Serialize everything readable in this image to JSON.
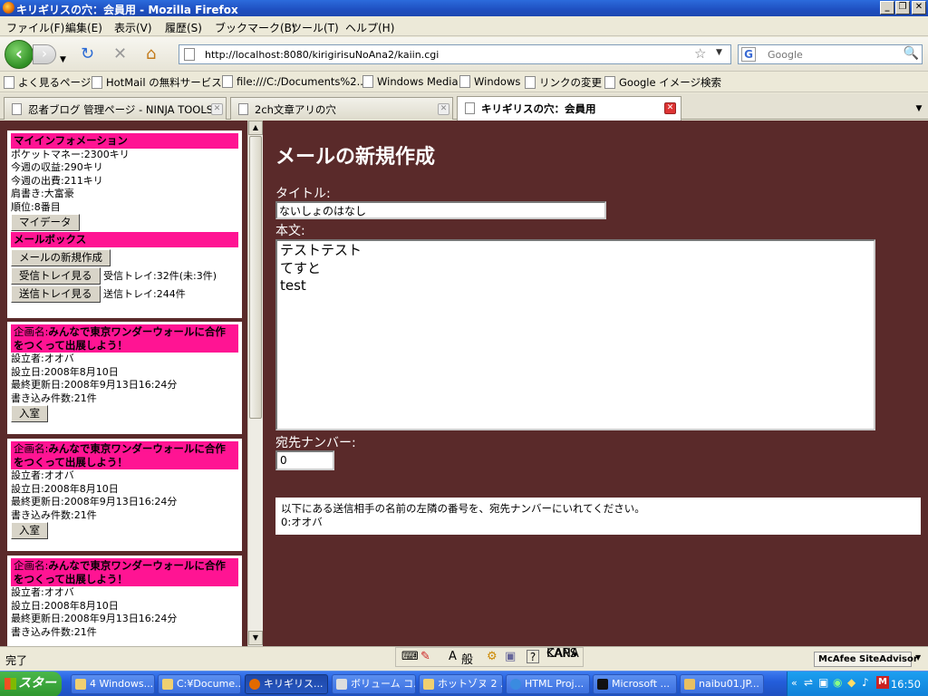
{
  "window": {
    "title": "キリギリスの穴：会員用 - Mozilla Firefox"
  },
  "menu": [
    "ファイル(F)",
    "編集(E)",
    "表示(V)",
    "履歴(S)",
    "ブックマーク(B)",
    "ツール(T)",
    "ヘルプ(H)"
  ],
  "nav": {
    "url": "http://localhost:8080/kirigirisuNoAna2/kaiin.cgi",
    "search_placeholder": "Google"
  },
  "bookmarks": [
    "よく見るページ",
    "HotMail の無料サービス",
    "file:///C:/Documents%2...",
    "Windows Media",
    "Windows",
    "リンクの変更",
    "Google イメージ検索"
  ],
  "tabs": [
    "忍者ブログ 管理ページ - NINJA TOOLS",
    "2ch文章アリの穴",
    "キリギリスの穴：会員用"
  ],
  "sidebar": {
    "info_header": "マイインフォメーション",
    "info_lines": [
      "ポケットマネー:2300キリ",
      "今週の収益:290キリ",
      "今週の出費:211キリ",
      "肩書き:大富豪",
      "順位:8番目"
    ],
    "mydata_button": "マイデータ",
    "mailbox_header": "メールボックス",
    "new_mail_button": "メールの新規作成",
    "inbox_button": "受信トレイ見る",
    "inbox_status": "受信トレイ:32件(未:3件)",
    "outbox_button": "送信トレイ見る",
    "outbox_status": "送信トレイ:244件",
    "projects": [
      {
        "name_prefix": "企画名:",
        "name": "みんなで東京ワンダーウォールに合作をつくって出展しよう！",
        "lines": [
          "設立者:オオバ",
          "設立日:2008年8月10日",
          "最終更新日:2008年9月13日16:24分",
          "書き込み件数:21件"
        ],
        "button": "入室"
      },
      {
        "name_prefix": "企画名:",
        "name": "みんなで東京ワンダーウォールに合作をつくって出展しよう！",
        "lines": [
          "設立者:オオバ",
          "設立日:2008年8月10日",
          "最終更新日:2008年9月13日16:24分",
          "書き込み件数:21件"
        ],
        "button": "入室"
      },
      {
        "name_prefix": "企画名:",
        "name": "みんなで東京ワンダーウォールに合作をつくって出展しよう！",
        "lines": [
          "設立者:オオバ",
          "設立日:2008年8月10日",
          "最終更新日:2008年9月13日16:24分",
          "書き込み件数:21件"
        ]
      }
    ]
  },
  "compose": {
    "heading": "メールの新規作成",
    "title_label": "タイトル:",
    "title_value": "ないしょのはなし",
    "body_label": "本文:",
    "body_value": "テストテスト\nてすと\ntest",
    "address_label": "宛先ナンバー:",
    "address_value": "0",
    "info_text": "以下にある送信相手の名前の左隣の番号を、宛先ナンバーにいれてください。",
    "recipients": [
      "0:オオバ"
    ]
  },
  "status": {
    "text": "完了",
    "ime": [
      "A",
      "般"
    ],
    "caps": "CAPS",
    "kana": "KANA",
    "mcafee": "McAfee SiteAdvisor"
  },
  "taskbar": {
    "start": "スタート",
    "tasks": [
      "4 Windows...",
      "C:¥Docume...",
      "キリギリス...",
      "ボリューム コ...",
      "ホットゾヌ 2 ...",
      "HTML Proj...",
      "Microsoft ...",
      "naibu01.JP..."
    ],
    "clock": "16:50"
  },
  "colors": {
    "page_bg": "#5a2a2a",
    "header_pink": "#ff1493"
  }
}
